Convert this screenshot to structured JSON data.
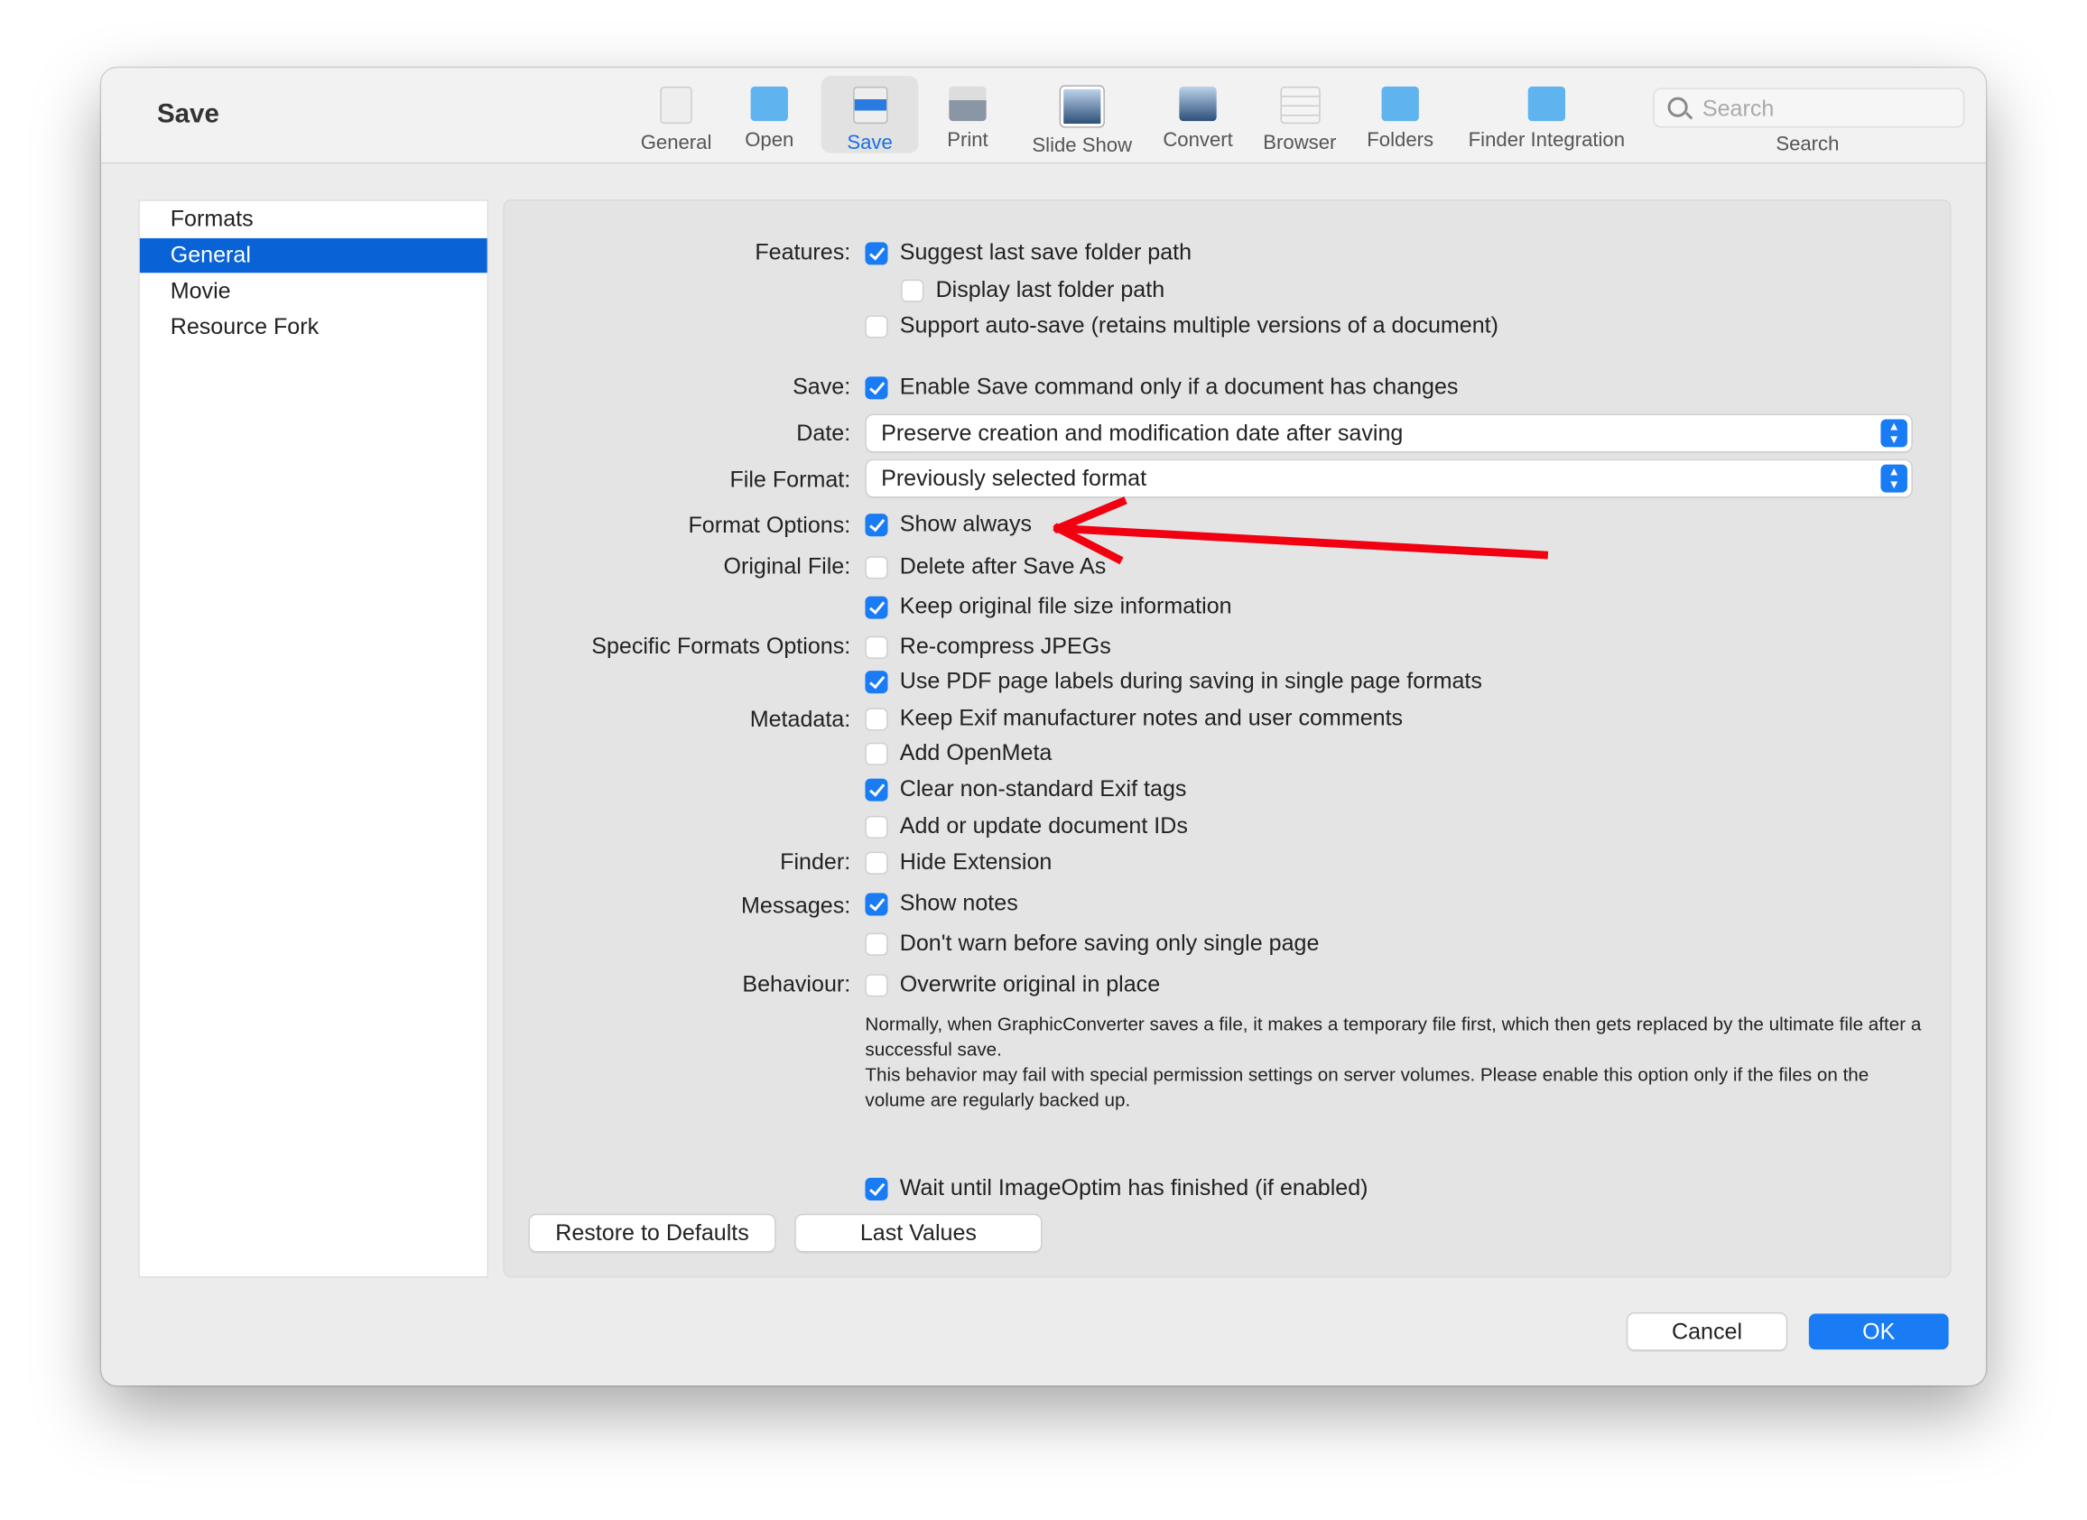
{
  "window": {
    "title": "Save"
  },
  "toolbar": {
    "items": [
      {
        "label": "General",
        "icon": "switch-icon"
      },
      {
        "label": "Open",
        "icon": "folder-brush-icon"
      },
      {
        "label": "Save",
        "icon": "file-formats-icon",
        "selected": true
      },
      {
        "label": "Print",
        "icon": "printer-icon"
      },
      {
        "label": "Slide Show",
        "icon": "slideshow-icon"
      },
      {
        "label": "Convert",
        "icon": "convert-icon"
      },
      {
        "label": "Browser",
        "icon": "browser-icon"
      },
      {
        "label": "Folders",
        "icon": "folder-photo-icon"
      },
      {
        "label": "Finder Integration",
        "icon": "folder-ext-icon"
      }
    ],
    "search_placeholder": "Search",
    "search_label": "Search"
  },
  "sidebar": {
    "items": [
      {
        "label": "Formats"
      },
      {
        "label": "General",
        "selected": true
      },
      {
        "label": "Movie"
      },
      {
        "label": "Resource Fork"
      }
    ]
  },
  "labels": {
    "features": "Features:",
    "save": "Save:",
    "date": "Date:",
    "file_format": "File Format:",
    "format_options": "Format Options:",
    "original_file": "Original File:",
    "specific": "Specific Formats Options:",
    "metadata": "Metadata:",
    "finder": "Finder:",
    "messages": "Messages:",
    "behaviour": "Behaviour:"
  },
  "options": [
    {
      "label": "Suggest last save folder path",
      "checked": true
    },
    {
      "label": "Display last folder path",
      "checked": false
    },
    {
      "label": "Support auto-save (retains multiple versions of a document)",
      "checked": false
    },
    {
      "label": "Enable Save command only if a document has changes",
      "checked": true
    },
    {
      "label": "Show always",
      "checked": true
    },
    {
      "label": "Delete after Save As",
      "checked": false
    },
    {
      "label": "Keep original file size information",
      "checked": true
    },
    {
      "label": "Re-compress JPEGs",
      "checked": false
    },
    {
      "label": "Use PDF page labels during saving in single page formats",
      "checked": true
    },
    {
      "label": "Keep Exif manufacturer notes and user comments",
      "checked": false
    },
    {
      "label": "Add OpenMeta",
      "checked": false
    },
    {
      "label": "Clear non-standard Exif tags",
      "checked": true
    },
    {
      "label": "Add or update document IDs",
      "checked": false
    },
    {
      "label": "Hide Extension",
      "checked": false
    },
    {
      "label": "Show notes",
      "checked": true
    },
    {
      "label": "Don't warn before saving only single page",
      "checked": false
    },
    {
      "label": "Overwrite original in place",
      "checked": false
    },
    {
      "label": "Wait until ImageOptim has finished (if enabled)",
      "checked": true
    }
  ],
  "popups": {
    "date": "Preserve creation and modification date after saving",
    "file_format": "Previously selected format"
  },
  "description": [
    "Normally, when GraphicConverter saves a file, it makes a temporary file first, which then gets replaced by the ultimate file after a successful save.",
    "This behavior may fail with special permission settings on server volumes. Please enable this option only if the files on the volume are regularly backed up."
  ],
  "buttons": {
    "restore": "Restore to Defaults",
    "last_values": "Last Values",
    "cancel": "Cancel",
    "ok": "OK"
  },
  "colors": {
    "accent": "#1a7cf5",
    "selection": "#0a63d6",
    "annotation_arrow": "#f00010"
  }
}
